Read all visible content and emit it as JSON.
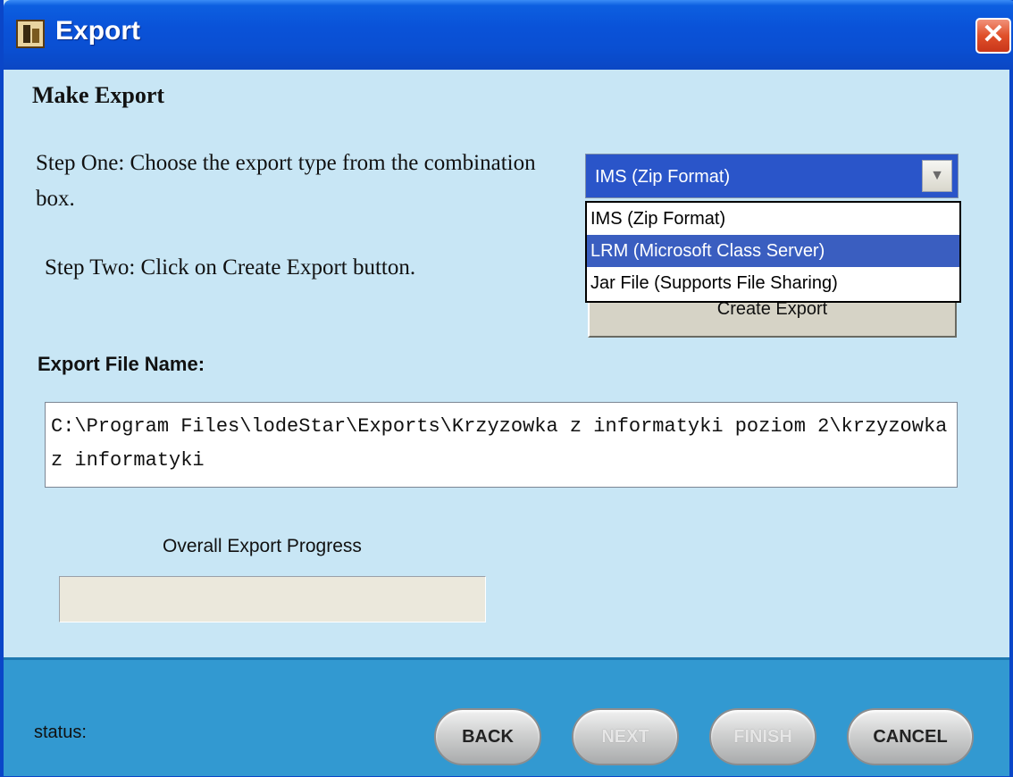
{
  "window": {
    "title": "Export",
    "close_symbol": "✕"
  },
  "content": {
    "heading": "Make Export",
    "step_one": "Step One:  Choose the export type from the combination box.",
    "step_two": "Step Two:  Click on Create Export button.",
    "export_type": {
      "selected_value": "IMS (Zip Format)",
      "options": [
        "IMS (Zip Format)",
        "LRM (Microsoft Class Server)",
        "Jar File (Supports File Sharing)"
      ],
      "highlighted_index": 1
    },
    "create_export_label": "Create Export",
    "export_file_label": "Export File Name:",
    "export_file_value": "C:\\Program Files\\lodeStar\\Exports\\Krzyzowka z informatyki poziom 2\\krzyzowka z informatyki",
    "progress_label": "Overall Export Progress",
    "progress_value": 0
  },
  "footer": {
    "status_label": "status:",
    "buttons": {
      "back": "BACK",
      "next": "NEXT",
      "finish": "FINISH",
      "cancel": "CANCEL"
    }
  },
  "colors": {
    "title_bar": "#0a52d8",
    "body_bg": "#c8e6f5",
    "footer_bg": "#3299d1",
    "selection": "#3a5ec0"
  }
}
